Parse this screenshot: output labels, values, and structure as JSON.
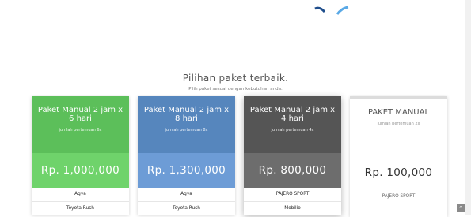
{
  "header": {
    "title": "Pilihan paket terbaik.",
    "subtitle": "Pilih paket sesuai dengan kebutuhan anda."
  },
  "colors": {
    "green": "#5cbf5a",
    "blue": "#5686bd",
    "dark": "#555555",
    "logo_dark": "#1f4e8c",
    "logo_light": "#5aa9e6"
  },
  "packages": [
    {
      "name": "Paket Manual 2 jam x 6 hari",
      "meta": "jumlah pertemuan 6x",
      "price": "Rp. 1,000,000",
      "cars": [
        "Agya",
        "Toyota Rush"
      ]
    },
    {
      "name": "Paket Manual 2 jam x 8 hari",
      "meta": "jumlah pertemuan 8x",
      "price": "Rp. 1,300,000",
      "cars": [
        "Agya",
        "Toyota Rush"
      ]
    },
    {
      "name": "Paket Manual 2 jam x 4 hari",
      "meta": "jumlah pertemuan 4x",
      "price": "Rp. 800,000",
      "cars": [
        "PAJERO SPORT",
        "Mobilio"
      ]
    },
    {
      "name": "PAKET MANUAL",
      "meta": "jumlah pertemuan 2x",
      "price": "Rp. 100,000",
      "cars": [
        "PAJERO SPORT",
        ""
      ]
    }
  ],
  "scroll_top_icon": "chevron-up-icon"
}
